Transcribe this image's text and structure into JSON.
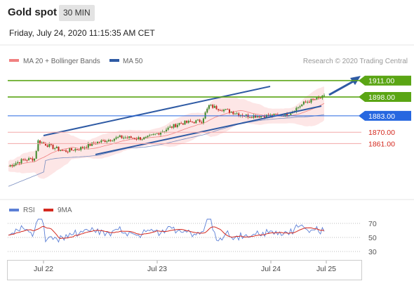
{
  "header": {
    "title": "Gold spot",
    "timeframe": "30 MIN"
  },
  "timestamp": "Friday, July 24, 2020 11:15:35 AM CET",
  "legend": {
    "ma20_label": "MA 20 + Bollinger Bands",
    "ma50_label": "MA 50",
    "credit": "Research © 2020 Trading Central"
  },
  "rsi_legend": {
    "rsi_label": "RSI",
    "ma_label": "9MA"
  },
  "colors": {
    "green": "#5aa514",
    "blue": "#2667e0",
    "red": "#d4291f",
    "trend": "#2e5aa4",
    "bands": "#fde3e3",
    "ma20": "#f08080",
    "ma50": "#7a8ec0",
    "up": "#3d8a2a",
    "down": "#c42a20"
  },
  "chart_data": [
    {
      "type": "candlestick",
      "title": "Gold spot",
      "x": [
        "Jul 22",
        "Jul 23",
        "Jul 24",
        "Jul 25"
      ],
      "ylim": [
        1816,
        1922
      ],
      "levels": [
        {
          "label": "1911.00",
          "value": 1911,
          "style": "resistance"
        },
        {
          "label": "1898.00",
          "value": 1898,
          "style": "resistance"
        },
        {
          "label": "1883.00",
          "value": 1883,
          "style": "pivot"
        },
        {
          "label": "1870.00",
          "value": 1870,
          "style": "support"
        },
        {
          "label": "1861.00",
          "value": 1861,
          "style": "support"
        }
      ],
      "series": [
        {
          "name": "MA 20 + Bollinger Bands"
        },
        {
          "name": "MA 50"
        }
      ]
    },
    {
      "type": "line",
      "title": "RSI",
      "y_ticks": [
        "70",
        "50",
        "30"
      ],
      "ylim": [
        20,
        80
      ],
      "series": [
        {
          "name": "RSI"
        },
        {
          "name": "9MA"
        }
      ]
    }
  ]
}
